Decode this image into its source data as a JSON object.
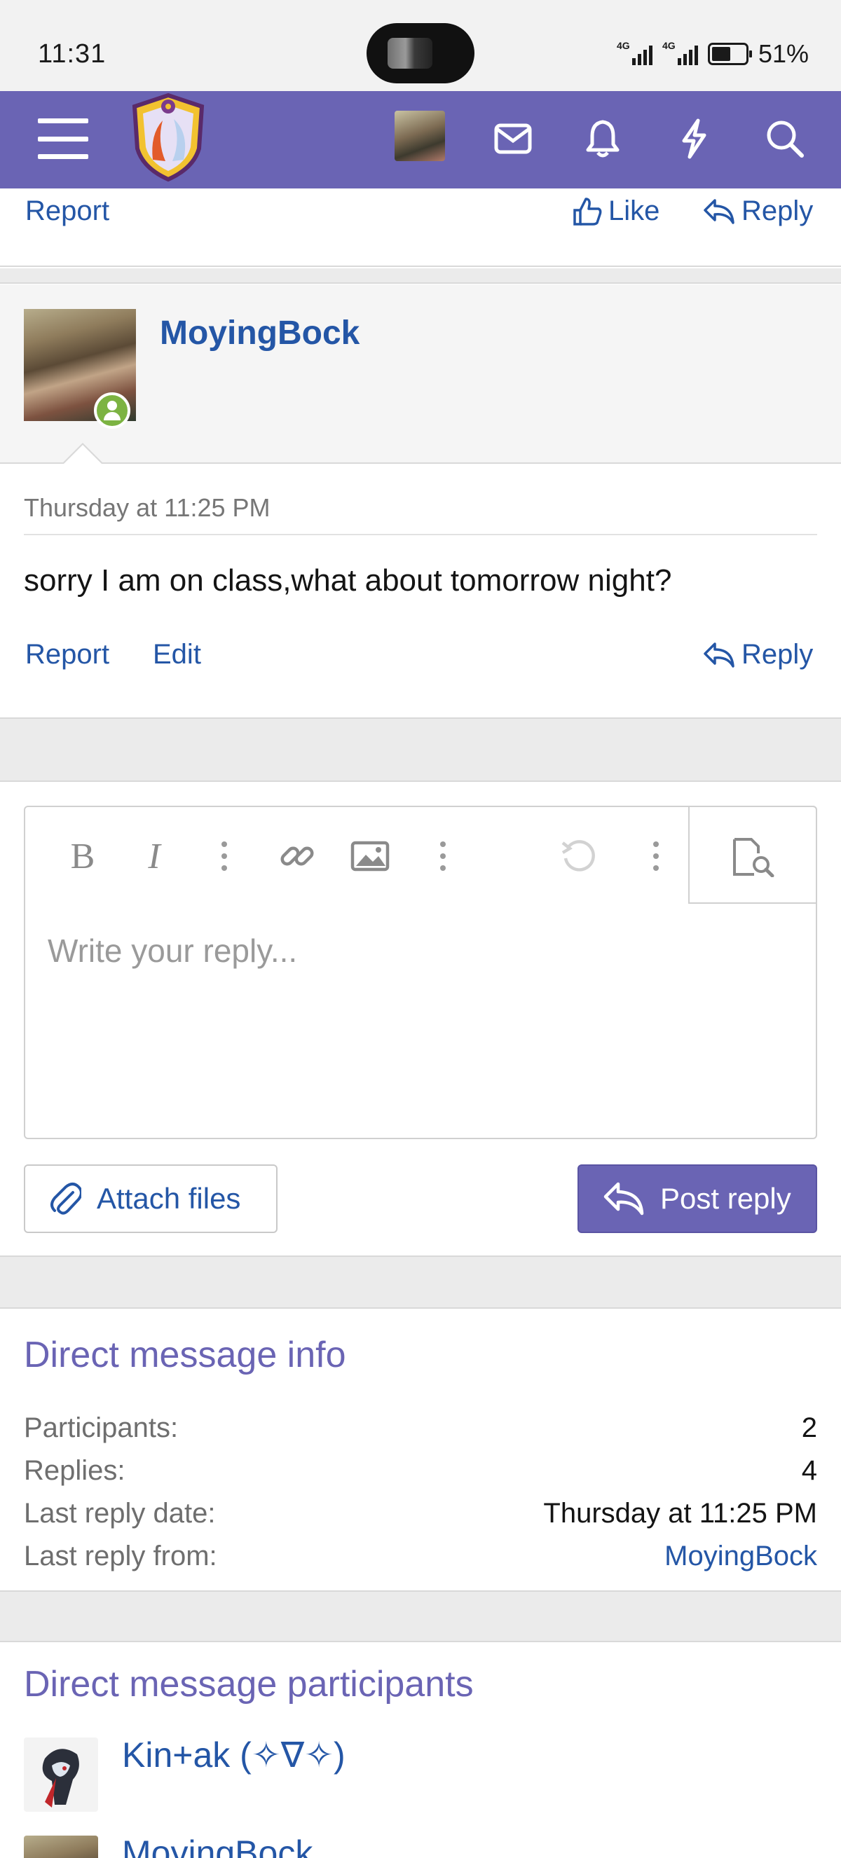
{
  "status_bar": {
    "time": "11:31",
    "network1": "4G",
    "network2": "4G",
    "battery": "51%"
  },
  "header": {
    "menu_icon": "hamburger-icon",
    "logo": "forum-logo",
    "icons": [
      "avatar",
      "envelope-icon",
      "bell-icon",
      "bolt-icon",
      "search-icon"
    ],
    "accent": "#6a64b4"
  },
  "prev_post": {
    "report": "Report",
    "like": "Like",
    "reply": "Reply"
  },
  "message": {
    "author": "MoyingBock",
    "date": "Thursday at 11:25 PM",
    "text": "sorry I am on class,what about tomorrow night?",
    "report": "Report",
    "edit": "Edit",
    "reply": "Reply"
  },
  "editor": {
    "placeholder": "Write your reply...",
    "toolbar": [
      "bold-icon",
      "italic-icon",
      "more-vertical-icon",
      "link-icon",
      "image-icon",
      "more-vertical-icon",
      "undo-icon",
      "more-vertical-icon",
      "preview-icon"
    ],
    "attach_label": "Attach files",
    "post_label": "Post reply"
  },
  "info": {
    "title": "Direct message info",
    "rows": [
      {
        "key": "Participants:",
        "value": "2"
      },
      {
        "key": "Replies:",
        "value": "4"
      },
      {
        "key": "Last reply date:",
        "value": "Thursday at 11:25 PM"
      },
      {
        "key": "Last reply from:",
        "value": "MoyingBock"
      }
    ]
  },
  "participants": {
    "title": "Direct message participants",
    "items": [
      {
        "name": "Kin+ak (✧∇✧)"
      },
      {
        "name": "MoyingBock"
      }
    ]
  }
}
